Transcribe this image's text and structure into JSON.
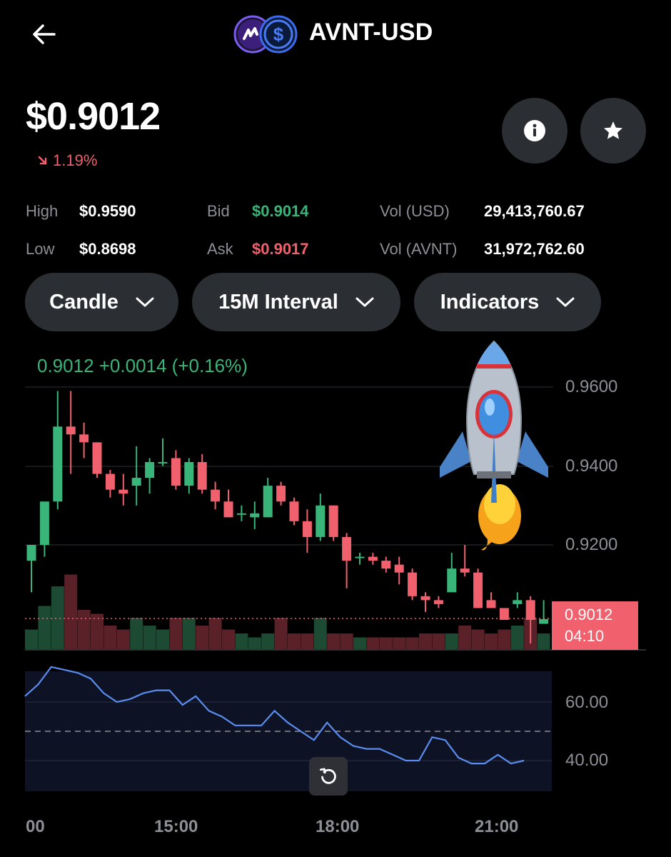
{
  "header": {
    "title": "AVNT-USD",
    "back_icon": "arrow-left-icon",
    "base_logo": "avantis-logo-icon",
    "quote_logo": "dollar-coin-icon"
  },
  "summary": {
    "price": "$0.9012",
    "change": "1.19%",
    "change_direction": "down",
    "info_icon": "info-icon",
    "favorite_icon": "star-icon"
  },
  "stats": {
    "high_label": "High",
    "high_value": "$0.9590",
    "low_label": "Low",
    "low_value": "$0.8698",
    "bid_label": "Bid",
    "bid_value": "$0.9014",
    "ask_label": "Ask",
    "ask_value": "$0.9017",
    "vol_usd_label": "Vol (USD)",
    "vol_usd_value": "29,413,760.67",
    "vol_avnt_label": "Vol (AVNT)",
    "vol_avnt_value": "31,972,762.60"
  },
  "controls": {
    "chart_type": "Candle",
    "interval": "15M Interval",
    "indicators": "Indicators"
  },
  "chart": {
    "ohlc_text": "0.9012   +0.0014 (+0.16%)",
    "last_price_tag": "0.9012",
    "countdown": "04:10",
    "price_axis": [
      "0.9600",
      "0.9400",
      "0.9200"
    ],
    "rsi_axis": [
      "60.00",
      "40.00"
    ],
    "time_axis": [
      "00",
      "15:00",
      "18:00",
      "21:00"
    ],
    "reset_icon": "rotate-left-icon",
    "sticker": "rocket-icon"
  },
  "colors": {
    "up": "#39b57a",
    "down": "#f0616d",
    "rsi": "#5b8def",
    "panel": "#2b2e33"
  },
  "chart_data": [
    {
      "type": "candlestick",
      "ylim": [
        0.894,
        0.966
      ],
      "candles": [
        {
          "o": 0.916,
          "h": 0.92,
          "l": 0.908,
          "c": 0.92
        },
        {
          "o": 0.92,
          "h": 0.929,
          "l": 0.917,
          "c": 0.931
        },
        {
          "o": 0.931,
          "h": 0.959,
          "l": 0.929,
          "c": 0.95
        },
        {
          "o": 0.95,
          "h": 0.959,
          "l": 0.938,
          "c": 0.948
        },
        {
          "o": 0.948,
          "h": 0.951,
          "l": 0.942,
          "c": 0.946
        },
        {
          "o": 0.946,
          "h": 0.946,
          "l": 0.937,
          "c": 0.938
        },
        {
          "o": 0.938,
          "h": 0.939,
          "l": 0.932,
          "c": 0.934
        },
        {
          "o": 0.934,
          "h": 0.938,
          "l": 0.93,
          "c": 0.933
        },
        {
          "o": 0.935,
          "h": 0.945,
          "l": 0.93,
          "c": 0.937
        },
        {
          "o": 0.937,
          "h": 0.942,
          "l": 0.933,
          "c": 0.941
        },
        {
          "o": 0.941,
          "h": 0.947,
          "l": 0.94,
          "c": 0.941
        },
        {
          "o": 0.942,
          "h": 0.944,
          "l": 0.934,
          "c": 0.935
        },
        {
          "o": 0.935,
          "h": 0.942,
          "l": 0.933,
          "c": 0.941
        },
        {
          "o": 0.941,
          "h": 0.943,
          "l": 0.933,
          "c": 0.934
        },
        {
          "o": 0.934,
          "h": 0.936,
          "l": 0.929,
          "c": 0.931
        },
        {
          "o": 0.931,
          "h": 0.934,
          "l": 0.927,
          "c": 0.927
        },
        {
          "o": 0.928,
          "h": 0.93,
          "l": 0.926,
          "c": 0.928
        },
        {
          "o": 0.927,
          "h": 0.931,
          "l": 0.924,
          "c": 0.928
        },
        {
          "o": 0.927,
          "h": 0.937,
          "l": 0.927,
          "c": 0.935
        },
        {
          "o": 0.935,
          "h": 0.936,
          "l": 0.93,
          "c": 0.931
        },
        {
          "o": 0.931,
          "h": 0.932,
          "l": 0.925,
          "c": 0.926
        },
        {
          "o": 0.926,
          "h": 0.929,
          "l": 0.918,
          "c": 0.922
        },
        {
          "o": 0.922,
          "h": 0.933,
          "l": 0.921,
          "c": 0.93
        },
        {
          "o": 0.93,
          "h": 0.93,
          "l": 0.921,
          "c": 0.922
        },
        {
          "o": 0.922,
          "h": 0.923,
          "l": 0.909,
          "c": 0.916
        },
        {
          "o": 0.917,
          "h": 0.918,
          "l": 0.915,
          "c": 0.917
        },
        {
          "o": 0.917,
          "h": 0.918,
          "l": 0.915,
          "c": 0.916
        },
        {
          "o": 0.916,
          "h": 0.917,
          "l": 0.913,
          "c": 0.914
        },
        {
          "o": 0.915,
          "h": 0.917,
          "l": 0.91,
          "c": 0.913
        },
        {
          "o": 0.913,
          "h": 0.914,
          "l": 0.906,
          "c": 0.907
        },
        {
          "o": 0.907,
          "h": 0.908,
          "l": 0.903,
          "c": 0.906
        },
        {
          "o": 0.906,
          "h": 0.907,
          "l": 0.904,
          "c": 0.905
        },
        {
          "o": 0.908,
          "h": 0.918,
          "l": 0.908,
          "c": 0.914
        },
        {
          "o": 0.914,
          "h": 0.92,
          "l": 0.912,
          "c": 0.913
        },
        {
          "o": 0.913,
          "h": 0.914,
          "l": 0.904,
          "c": 0.904
        },
        {
          "o": 0.906,
          "h": 0.908,
          "l": 0.904,
          "c": 0.904
        },
        {
          "o": 0.904,
          "h": 0.904,
          "l": 0.901,
          "c": 0.901
        },
        {
          "o": 0.905,
          "h": 0.908,
          "l": 0.904,
          "c": 0.906
        },
        {
          "o": 0.906,
          "h": 0.907,
          "l": 0.895,
          "c": 0.901
        },
        {
          "o": 0.9,
          "h": 0.906,
          "l": 0.9,
          "c": 0.9012
        }
      ],
      "volume_relative": [
        0.25,
        0.55,
        0.8,
        0.95,
        0.5,
        0.45,
        0.3,
        0.25,
        0.4,
        0.3,
        0.25,
        0.4,
        0.4,
        0.3,
        0.4,
        0.25,
        0.2,
        0.15,
        0.2,
        0.4,
        0.2,
        0.2,
        0.4,
        0.2,
        0.2,
        0.15,
        0.15,
        0.15,
        0.15,
        0.15,
        0.2,
        0.2,
        0.2,
        0.3,
        0.25,
        0.2,
        0.25,
        0.3,
        0.4,
        0.2
      ]
    },
    {
      "type": "line",
      "name": "RSI",
      "ylim": [
        30,
        76
      ],
      "midline": 50,
      "values": [
        62,
        66,
        72,
        71,
        70,
        68,
        63,
        60,
        61,
        63,
        64,
        64,
        59,
        62,
        57,
        55,
        52,
        52,
        52,
        57,
        53,
        50,
        47,
        53,
        48,
        45,
        44,
        44,
        42,
        40,
        40,
        48,
        47,
        41,
        39,
        39,
        42,
        39,
        40
      ]
    }
  ]
}
